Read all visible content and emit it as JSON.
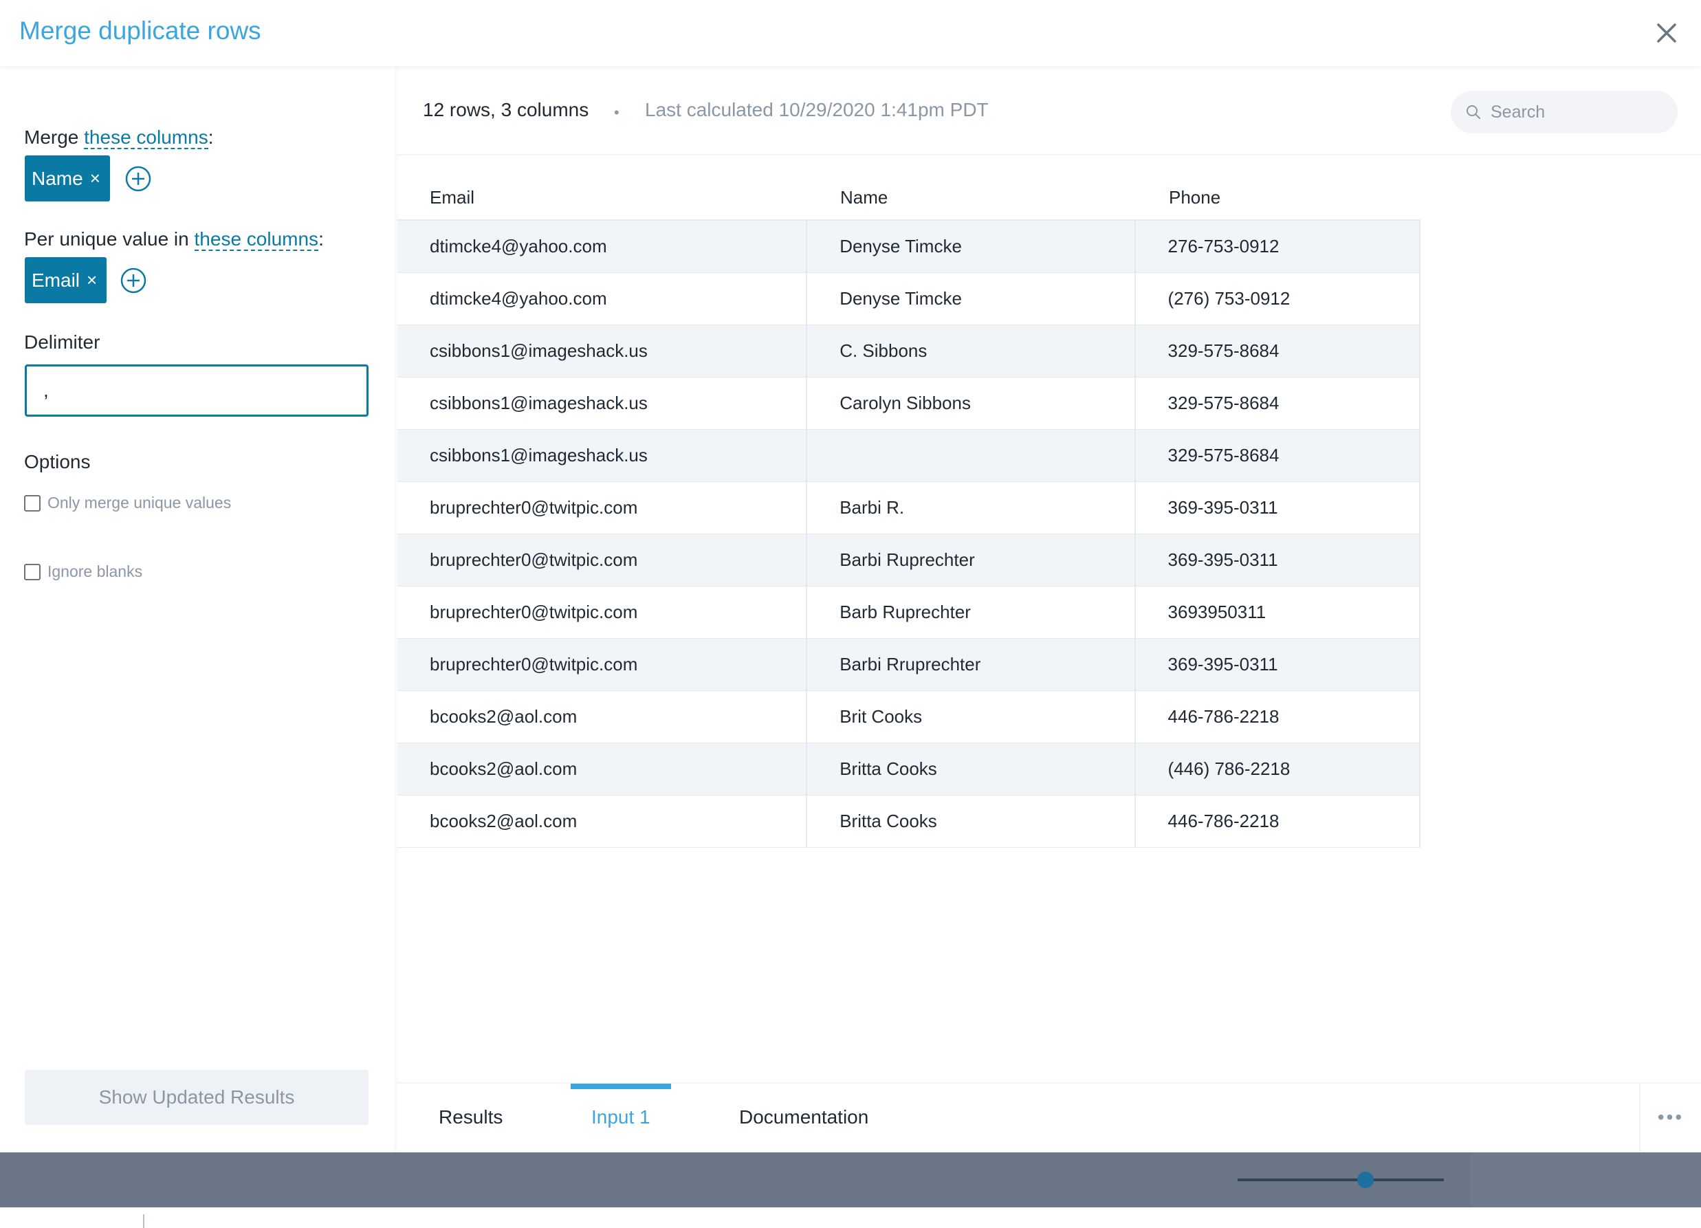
{
  "header": {
    "title": "Merge duplicate rows"
  },
  "sidebar": {
    "merge_prefix": "Merge ",
    "merge_link": "these columns",
    "merge_colon": ":",
    "merge_pill": "Name",
    "per_prefix": "Per unique value in ",
    "per_link": "these columns",
    "per_colon": ":",
    "per_pill": "Email",
    "pill_remove": "×",
    "delimiter_label": "Delimiter",
    "delimiter_value": ",",
    "options_label": "Options",
    "option_unique": "Only merge unique values",
    "option_blanks": "Ignore blanks",
    "show_button": "Show Updated Results"
  },
  "summary": {
    "rows_cols": "12 rows, 3 columns",
    "dot": "•",
    "last_calculated": "Last calculated 10/29/2020 1:41pm PDT"
  },
  "search": {
    "placeholder": "Search"
  },
  "table": {
    "headers": [
      "Email",
      "Name",
      "Phone"
    ],
    "rows": [
      [
        "dtimcke4@yahoo.com",
        "Denyse Timcke",
        "276-753-0912"
      ],
      [
        "dtimcke4@yahoo.com",
        "Denyse Timcke",
        "(276) 753-0912"
      ],
      [
        "csibbons1@imageshack.us",
        "C. Sibbons",
        "329-575-8684"
      ],
      [
        "csibbons1@imageshack.us",
        "Carolyn Sibbons",
        "329-575-8684"
      ],
      [
        "csibbons1@imageshack.us",
        "",
        "329-575-8684"
      ],
      [
        "bruprechter0@twitpic.com",
        "Barbi R.",
        "369-395-0311"
      ],
      [
        "bruprechter0@twitpic.com",
        "Barbi Ruprechter",
        "369-395-0311"
      ],
      [
        "bruprechter0@twitpic.com",
        "Barb Ruprechter",
        "3693950311"
      ],
      [
        "bruprechter0@twitpic.com",
        "Barbi Rruprechter",
        "369-395-0311"
      ],
      [
        "bcooks2@aol.com",
        "Brit Cooks",
        "446-786-2218"
      ],
      [
        "bcooks2@aol.com",
        "Britta Cooks",
        "(446) 786-2218"
      ],
      [
        "bcooks2@aol.com",
        "Britta Cooks",
        "446-786-2218"
      ]
    ]
  },
  "tabs": [
    {
      "label": "Results",
      "active": false
    },
    {
      "label": "Input 1",
      "active": true
    },
    {
      "label": "Documentation",
      "active": false
    }
  ],
  "more_label": "•••",
  "zoom_slider": {
    "level": 0.62
  },
  "colors": {
    "accent": "#3ba5e0",
    "primary": "#0a7aa5",
    "statusbar": "#6a7685"
  },
  "icons": {
    "close": "close-icon",
    "add": "plus-circle-icon",
    "search": "search-icon"
  }
}
